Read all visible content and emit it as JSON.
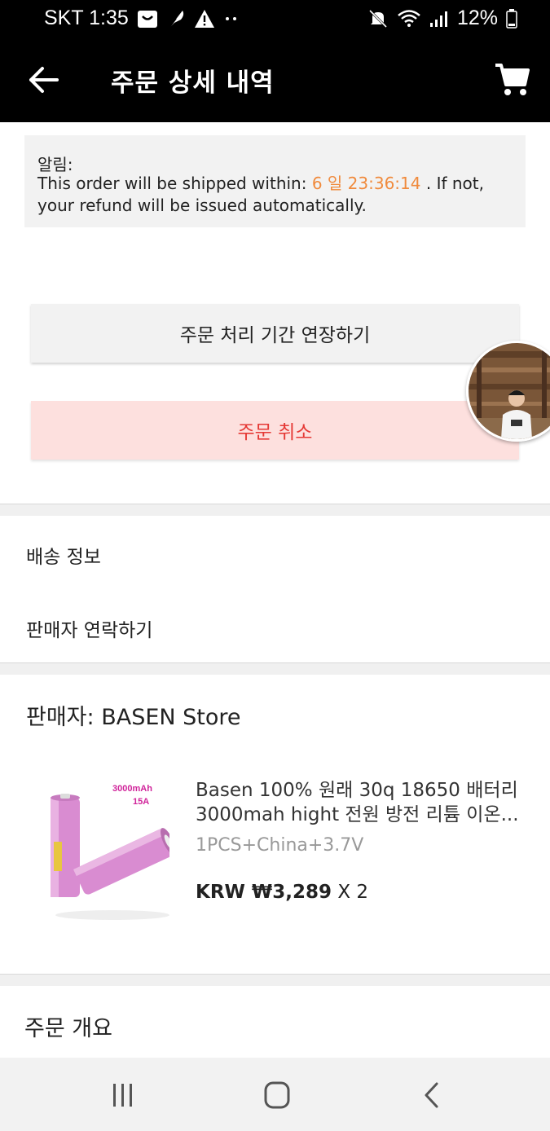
{
  "status_bar": {
    "carrier_time": "SKT 1:35",
    "battery": "12%"
  },
  "app_bar": {
    "title": "주문 상세 내역",
    "back_icon": "arrow-left-icon",
    "cart_icon": "shopping-cart-icon"
  },
  "notice": {
    "label": "알림:",
    "text_before": "This order will be shipped within: ",
    "countdown": "6 일 23:36:14",
    "text_after": " . If not, your refund will be issued automatically."
  },
  "actions": {
    "extend_label": "주문 처리 기간 연장하기",
    "cancel_label": "주문 취소"
  },
  "menu": {
    "shipping_info": "배송 정보",
    "contact_seller": "판매자 연락하기"
  },
  "seller": {
    "label": "판매자: BASEN Store"
  },
  "product": {
    "image_caption_1": "3000mAh",
    "image_caption_2": "15A",
    "title_line1": "Basen 100% 원래 30q 18650 배터리",
    "title_line2": "3000mah hight 전원 방전 리튬 이온...",
    "variant": "1PCS+China+3.7V",
    "price": "KRW ₩3,289",
    "quantity": "X 2"
  },
  "summary": {
    "label": "주문 개요"
  },
  "colors": {
    "countdown": "#f08a3c",
    "cancel_text": "#e53935",
    "cancel_bg": "#fde0de"
  }
}
